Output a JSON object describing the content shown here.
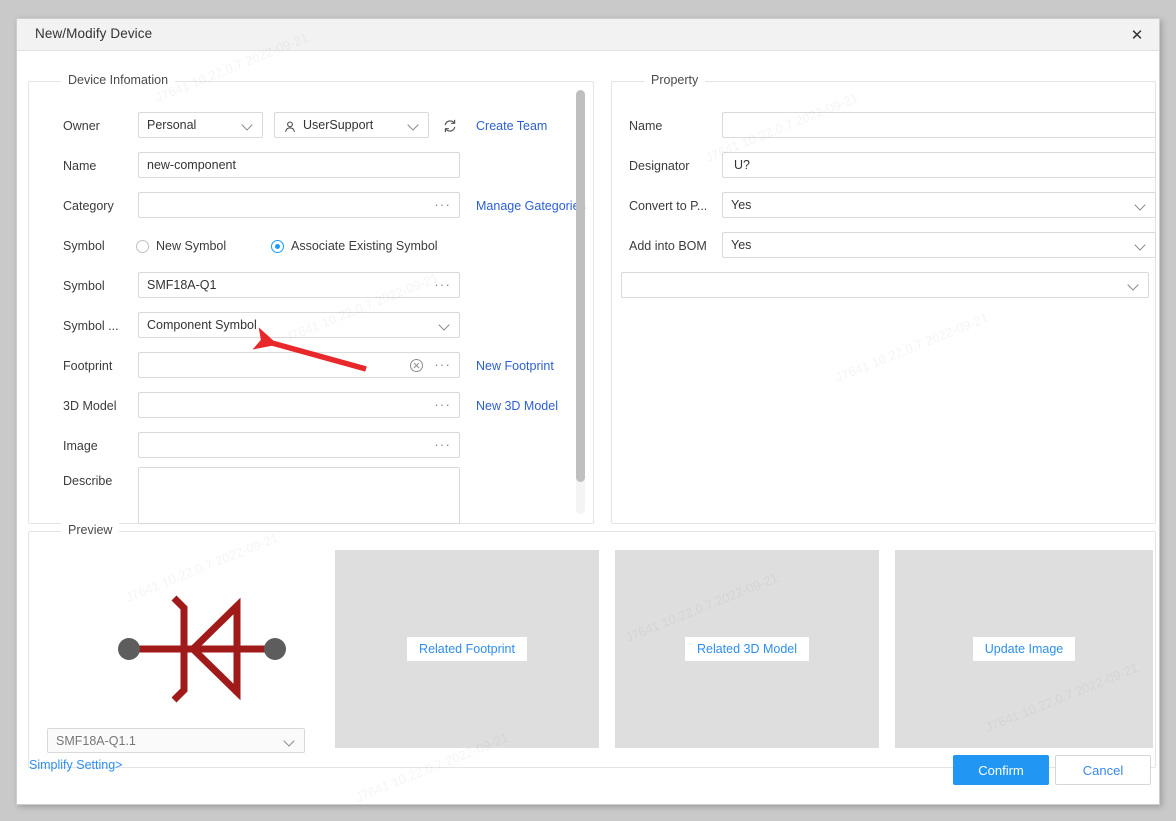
{
  "window": {
    "title": "New/Modify Device",
    "close_icon": "close-icon"
  },
  "device_information": {
    "legend": "Device Infomation",
    "owner": {
      "label": "Owner",
      "scope_value": "Personal",
      "user_value": "UserSupport",
      "user_icon": "user-icon",
      "refresh_icon": "refresh-icon",
      "create_team_link": "Create Team"
    },
    "name": {
      "label": "Name",
      "value": "new-component"
    },
    "category": {
      "label": "Category",
      "value": "",
      "browse_icon": "ellipsis-icon",
      "manage_link": "Manage Gategories"
    },
    "symbol_mode": {
      "label": "Symbol",
      "options": [
        "New Symbol",
        "Associate Existing Symbol"
      ],
      "selected": "Associate Existing Symbol"
    },
    "symbol": {
      "label": "Symbol",
      "value": "SMF18A-Q1",
      "browse_icon": "ellipsis-icon"
    },
    "symbol_type": {
      "label": "Symbol ...",
      "value": "Component Symbol"
    },
    "footprint": {
      "label": "Footprint",
      "value": "",
      "clear_icon": "clear-circle-icon",
      "browse_icon": "ellipsis-icon",
      "new_link": "New Footprint"
    },
    "model3d": {
      "label": "3D Model",
      "value": "",
      "browse_icon": "ellipsis-icon",
      "new_link": "New 3D Model"
    },
    "image": {
      "label": "Image",
      "value": "",
      "browse_icon": "ellipsis-icon"
    },
    "describe": {
      "label": "Describe",
      "value": ""
    }
  },
  "property": {
    "legend": "Property",
    "name": {
      "label": "Name",
      "value": ""
    },
    "designator": {
      "label": "Designator",
      "value": "U?"
    },
    "convert_to_pcb": {
      "label": "Convert to P...",
      "value": "Yes"
    },
    "add_into_bom": {
      "label": "Add into BOM",
      "value": "Yes"
    },
    "extra": {
      "label": "",
      "value": ""
    }
  },
  "preview": {
    "legend": "Preview",
    "symbol_select_value": "SMF18A-Q1.1",
    "symbol_graphic": "zener-diode-symbol",
    "footprint_placeholder": "Related Footprint",
    "model3d_placeholder": "Related 3D Model",
    "image_placeholder": "Update Image"
  },
  "footer": {
    "simplify_link": "Simplify Setting>",
    "confirm_label": "Confirm",
    "cancel_label": "Cancel"
  },
  "colors": {
    "accent_blue": "#2196f3",
    "link_blue": "#2e8ef0",
    "symbol_red": "#a01a1a",
    "annotation_red": "#e8282b",
    "placeholder_gray": "#dedede"
  },
  "annotation": {
    "arrow": "red-pointer-arrow"
  },
  "watermarks": [
    "J7641  10.22.0.7  2022-09-21",
    "J7641  10.22.0.7  2022-09-21",
    "J7641  10.22.0.7  2022-09-21",
    "J7641  10.22.0.7  2022-09-21",
    "J7641  10.22.0.7  2022-09-21",
    "J7641  10.22.0.7  2022-09-21",
    "J7641  10.22.0.7  2022-09-21",
    "J7641  10.22.0.7  2022-09-21"
  ]
}
